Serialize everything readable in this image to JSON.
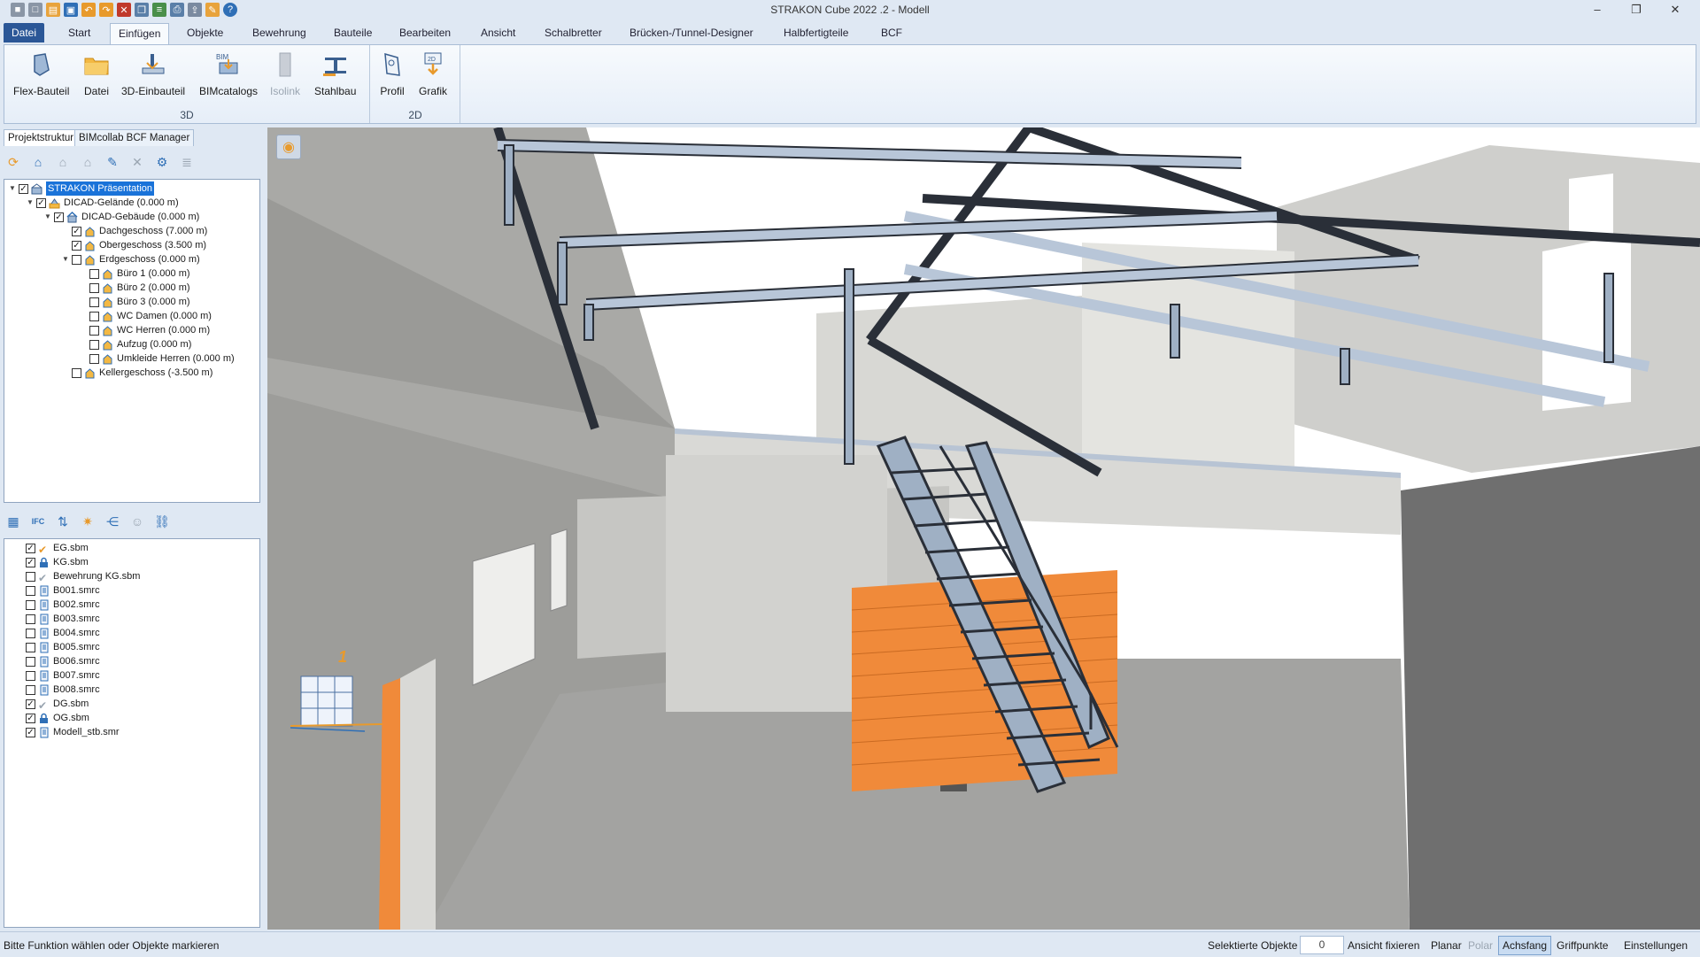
{
  "window": {
    "title": "STRAKON Cube 2022 .2 - Modell",
    "controls": [
      "–",
      "❐",
      "✕"
    ]
  },
  "ribbon": {
    "tabs": [
      "Datei",
      "Start",
      "Einfügen",
      "Objekte",
      "Bewehrung",
      "Bauteile",
      "Bearbeiten",
      "Ansicht",
      "Schalbretter",
      "Brücken-/Tunnel-Designer",
      "Halbfertigteile",
      "BCF"
    ],
    "active_tab": "Einfügen",
    "groups": [
      {
        "label": "3D",
        "buttons": [
          {
            "label": "Flex-Bauteil",
            "icon": "flex-part-icon"
          },
          {
            "label": "Datei",
            "icon": "folder-icon"
          },
          {
            "label": "3D-Einbauteil",
            "icon": "insert-part-icon"
          },
          {
            "label": "BIMcatalogs",
            "icon": "bim-catalog-icon"
          },
          {
            "label": "Isolink",
            "icon": "isolink-icon",
            "disabled": true
          },
          {
            "label": "Stahlbau",
            "icon": "steel-icon"
          }
        ]
      },
      {
        "label": "2D",
        "buttons": [
          {
            "label": "Profil",
            "icon": "profile-icon"
          },
          {
            "label": "Grafik",
            "icon": "graphic-icon"
          }
        ]
      }
    ]
  },
  "left_panel": {
    "tabs": [
      "Projektstruktur",
      "BIMcollab BCF Manager"
    ],
    "active_tab": "Projektstruktur",
    "structure_tree": [
      {
        "label": "STRAKON Präsentation",
        "level": 0,
        "checked": true,
        "expanded": true,
        "selected": true
      },
      {
        "label": "DICAD-Gelände (0.000 m)",
        "level": 1,
        "checked": true,
        "expanded": true
      },
      {
        "label": "DICAD-Gebäude (0.000 m)",
        "level": 2,
        "checked": true,
        "expanded": true
      },
      {
        "label": "Dachgeschoss (7.000 m)",
        "level": 3,
        "checked": true
      },
      {
        "label": "Obergeschoss (3.500 m)",
        "level": 3,
        "checked": true
      },
      {
        "label": "Erdgeschoss (0.000 m)",
        "level": 3,
        "checked": false,
        "expanded": true
      },
      {
        "label": "Büro 1 (0.000 m)",
        "level": 4,
        "checked": false
      },
      {
        "label": "Büro 2 (0.000 m)",
        "level": 4,
        "checked": false
      },
      {
        "label": "Büro 3 (0.000 m)",
        "level": 4,
        "checked": false
      },
      {
        "label": "WC Damen (0.000 m)",
        "level": 4,
        "checked": false
      },
      {
        "label": "WC Herren (0.000 m)",
        "level": 4,
        "checked": false
      },
      {
        "label": "Aufzug (0.000 m)",
        "level": 4,
        "checked": false
      },
      {
        "label": "Umkleide Herren (0.000 m)",
        "level": 4,
        "checked": false
      },
      {
        "label": "Kellergeschoss (-3.500 m)",
        "level": 3,
        "checked": false
      }
    ],
    "files": [
      {
        "label": "EG.sbm",
        "checked": true,
        "icon": "check-icon"
      },
      {
        "label": "KG.sbm",
        "checked": true,
        "icon": "lock-icon"
      },
      {
        "label": "Bewehrung KG.sbm",
        "checked": false,
        "icon": "check-icon"
      },
      {
        "label": "B001.smrc",
        "checked": false,
        "icon": "doc-icon"
      },
      {
        "label": "B002.smrc",
        "checked": false,
        "icon": "doc-icon"
      },
      {
        "label": "B003.smrc",
        "checked": false,
        "icon": "doc-icon"
      },
      {
        "label": "B004.smrc",
        "checked": false,
        "icon": "doc-icon"
      },
      {
        "label": "B005.smrc",
        "checked": false,
        "icon": "doc-icon"
      },
      {
        "label": "B006.smrc",
        "checked": false,
        "icon": "doc-icon"
      },
      {
        "label": "B007.smrc",
        "checked": false,
        "icon": "doc-icon"
      },
      {
        "label": "B008.smrc",
        "checked": false,
        "icon": "doc-icon"
      },
      {
        "label": "DG.sbm",
        "checked": true,
        "icon": "check-icon"
      },
      {
        "label": "OG.sbm",
        "checked": true,
        "icon": "lock-icon"
      },
      {
        "label": "Modell_stb.smr",
        "checked": true,
        "icon": "doc-icon"
      }
    ]
  },
  "viewport": {
    "cube_label": "1"
  },
  "statusbar": {
    "message": "Bitte Funktion wählen oder Objekte markieren",
    "selected_label": "Selektierte Objekte",
    "selected_count": "0",
    "toggles": [
      {
        "label": "Ansicht fixieren",
        "state": "normal"
      },
      {
        "label": "Planar",
        "state": "normal"
      },
      {
        "label": "Polar",
        "state": "off"
      },
      {
        "label": "Achsfang",
        "state": "on"
      },
      {
        "label": "Griffpunkte",
        "state": "normal"
      },
      {
        "label": "Einstellungen",
        "state": "normal"
      }
    ]
  }
}
